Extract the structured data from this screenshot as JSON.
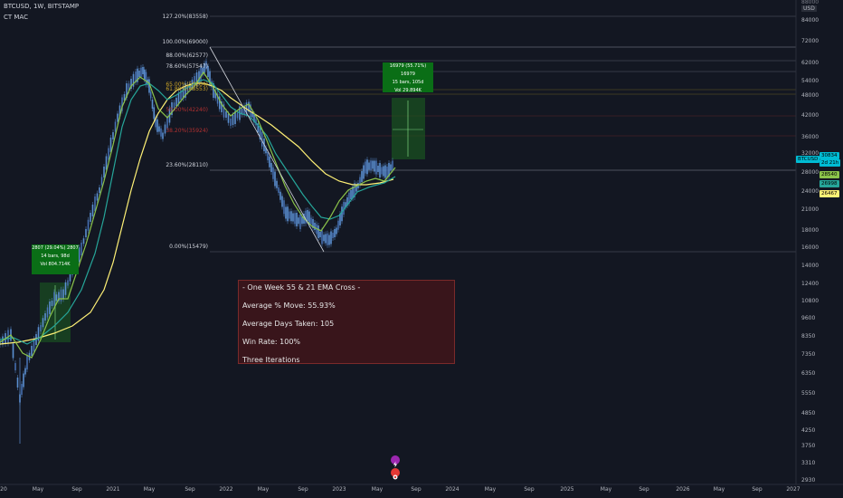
{
  "header": {
    "symbol_line": "BTCUSD, 1W, BITSTAMP",
    "indicator": "CT MAC"
  },
  "info_box": {
    "lines": [
      "- One Week 55 & 21 EMA Cross -",
      "Average % Move: 55.93%",
      "Average Days Taken: 105",
      "Win Rate: 100%",
      "Three Iterations"
    ]
  },
  "price_scale": {
    "currency": "USD",
    "top_partial": "88000",
    "labels": [
      "84000",
      "72000",
      "62000",
      "54000",
      "48000",
      "42000",
      "36000",
      "32000",
      "28000",
      "24000",
      "21000",
      "18000",
      "16000",
      "14000",
      "12400",
      "10800",
      "9600",
      "8350",
      "7350",
      "6350",
      "5550",
      "4850",
      "4250",
      "3750",
      "3310",
      "2930"
    ]
  },
  "price_tags": [
    {
      "text": "BTCUSD",
      "color": "#00bcd4",
      "text_color": "#000000"
    },
    {
      "text": "30834",
      "color": "#00bcd4",
      "text_color": "#000000"
    },
    {
      "text": "2d 21h",
      "color": "#00bcd4",
      "text_color": "#000000"
    },
    {
      "text": "28540",
      "color": "#8bc34a",
      "text_color": "#000000"
    },
    {
      "text": "26998",
      "color": "#26a69a",
      "text_color": "#000000"
    },
    {
      "text": "26467",
      "color": "#fff176",
      "text_color": "#000000"
    }
  ],
  "time_axis": {
    "labels": [
      "20",
      "May",
      "Sep",
      "2021",
      "May",
      "Sep",
      "2022",
      "May",
      "Sep",
      "2023",
      "May",
      "Sep",
      "2024",
      "May",
      "Sep",
      "2025",
      "May",
      "Sep",
      "2026",
      "May",
      "Sep",
      "2027"
    ]
  },
  "fib_levels": [
    {
      "label": "127.20%(83558)",
      "color": "#d1d4dc"
    },
    {
      "label": "100.00%(69000)",
      "color": "#d1d4dc"
    },
    {
      "label": "88.00%(62577)",
      "color": "#d1d4dc"
    },
    {
      "label": "78.60%(57547)",
      "color": "#d1d4dc"
    },
    {
      "label": "65.00%(50264)",
      "color": "#c9a227"
    },
    {
      "label": "61.80%(48553)",
      "color": "#c9a227"
    },
    {
      "label": "50.00%(42240)",
      "color": "#b03030"
    },
    {
      "label": "38.20%(35924)",
      "color": "#b03030"
    },
    {
      "label": "23.60%(28110)",
      "color": "#d1d4dc"
    },
    {
      "label": "0.00%(15479)",
      "color": "#d1d4dc"
    }
  ],
  "measure_boxes": [
    {
      "lines": [
        "2807 (29.04%) 2807",
        "14 bars, 98d",
        "Vol 804.714K"
      ]
    },
    {
      "lines": [
        "16979 (55.71%) 16979",
        "15 bars, 105d",
        "Vol 29.894K"
      ]
    }
  ],
  "colors": {
    "background": "#131722",
    "ema_fast": "#8bc34a",
    "ema_mid": "#26a69a",
    "ema_slow": "#fff176",
    "candles": "#5b8fd1",
    "measure_green": "#0a6e16"
  },
  "icons": [
    "lightning-icon",
    "event-flag-icon"
  ]
}
